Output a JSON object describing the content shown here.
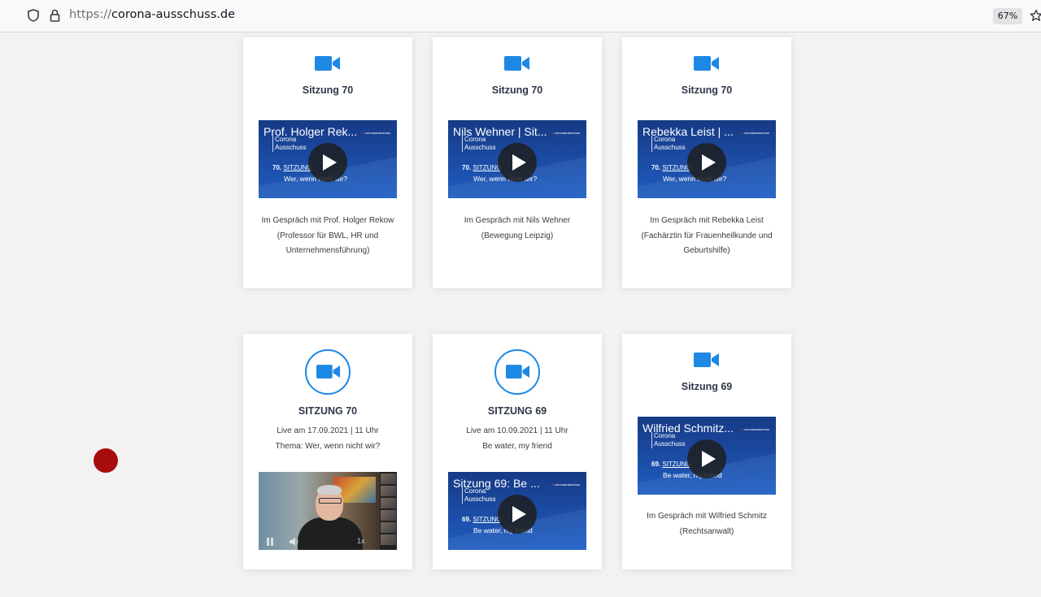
{
  "browser": {
    "url_protocol": "https://",
    "url_host": "corona-ausschuss.de",
    "zoom": "67%"
  },
  "colors": {
    "accent": "#1e88e5",
    "record_dot": "#a80d0d"
  },
  "cards": [
    {
      "title": "Sitzung 70",
      "icon": "video-camera-icon",
      "video": {
        "title": "Prof. Holger Rek...",
        "channel_logo": "coronaausschuss",
        "corona_lines": [
          "Corona",
          "Ausschuss"
        ],
        "session_label_prefix": "70.",
        "session_label_word": "SITZUNG",
        "subtitle": "Wer, wenn nicht wir?"
      },
      "desc": [
        "Im Gespräch mit Prof. Holger Rekow",
        "(Professor für BWL, HR und",
        "Unternehmensführung)"
      ]
    },
    {
      "title": "Sitzung 70",
      "icon": "video-camera-icon",
      "video": {
        "title": "Nils Wehner | Sit...",
        "channel_logo": "coronaausschuss",
        "corona_lines": [
          "Corona",
          "Ausschuss"
        ],
        "session_label_prefix": "70.",
        "session_label_word": "SITZUNG",
        "subtitle": "Wer, wenn nicht wir?"
      },
      "desc": [
        "Im Gespräch mit Nils Wehner",
        "(Bewegung Leipzig)"
      ]
    },
    {
      "title": "Sitzung 70",
      "icon": "video-camera-icon",
      "video": {
        "title": "Rebekka Leist | ...",
        "channel_logo": "coronaausschuss",
        "corona_lines": [
          "Corona",
          "Ausschuss"
        ],
        "session_label_prefix": "70.",
        "session_label_word": "SITZUNG",
        "subtitle": "Wer, wenn nicht wir?"
      },
      "desc": [
        "Im Gespräch mit Rebekka Leist",
        "(Fachärztin für Frauenheilkunde und",
        "Geburtshilfe)"
      ]
    },
    {
      "title": "SITZUNG 70",
      "icon": "video-camera-circle-icon",
      "info": [
        "Live am 17.09.2021 | 11 Uhr",
        "Thema: Wer, wenn nicht wir?"
      ],
      "player": {
        "speed": "1x"
      }
    },
    {
      "title": "SITZUNG 69",
      "icon": "video-camera-circle-icon",
      "info": [
        "Live am 10.09.2021 | 11 Uhr",
        "Be water, my friend"
      ],
      "video": {
        "title": "Sitzung 69: Be ...",
        "channel_logo": "coronaausschuss",
        "corona_lines": [
          "Corona",
          "Ausschuss"
        ],
        "session_label_prefix": "69.",
        "session_label_word": "SITZUNG",
        "subtitle": "Be water, my friend"
      }
    },
    {
      "title": "Sitzung 69",
      "icon": "video-camera-icon",
      "video": {
        "title": "Wilfried Schmitz...",
        "channel_logo": "coronaausschuss",
        "corona_lines": [
          "Corona",
          "Ausschuss"
        ],
        "session_label_prefix": "69.",
        "session_label_word": "SITZUNG",
        "subtitle": "Be water, my friend"
      },
      "desc": [
        "Im Gespräch mit Wilfried Schmitz",
        "(Rechtsanwalt)"
      ]
    }
  ]
}
